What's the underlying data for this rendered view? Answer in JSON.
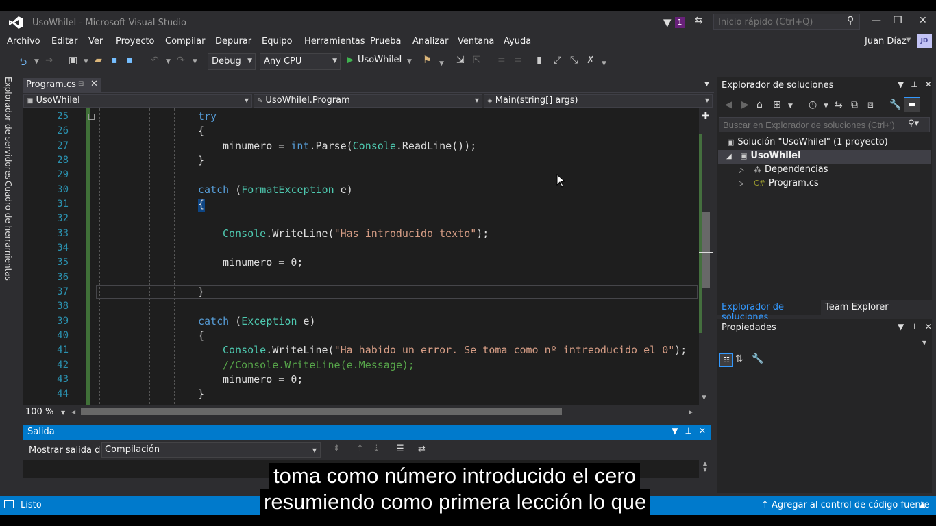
{
  "window": {
    "title": "UsoWhileI - Microsoft Visual Studio",
    "notification_count": "1",
    "quick_launch_placeholder": "Inicio rápido (Ctrl+Q)",
    "user_name": "Juan Díaz",
    "user_initials": "JD"
  },
  "menu": [
    "Archivo",
    "Editar",
    "Ver",
    "Proyecto",
    "Compilar",
    "Depurar",
    "Equipo",
    "Herramientas",
    "Prueba",
    "Analizar",
    "Ventana",
    "Ayuda"
  ],
  "toolbar": {
    "configuration": "Debug",
    "platform": "Any CPU",
    "run_label": "UsoWhileI"
  },
  "left_tabs": [
    "Explorador de servidores",
    "Cuadro de herramientas"
  ],
  "editor": {
    "tab_label": "Program.cs",
    "nav_project": "UsoWhileI",
    "nav_class": "UsoWhileI.Program",
    "nav_member": "Main(string[] args)",
    "zoom": "100 %",
    "line_numbers": [
      "25",
      "26",
      "27",
      "28",
      "29",
      "30",
      "31",
      "32",
      "33",
      "34",
      "35",
      "36",
      "37",
      "38",
      "39",
      "40",
      "41",
      "42",
      "43",
      "44"
    ]
  },
  "code": {
    "l25": "try",
    "l26": "{",
    "l27_a": "minumero = ",
    "l27_b": "int",
    "l27_c": ".Parse(",
    "l27_d": "Console",
    "l27_e": ".ReadLine());",
    "l28": "}",
    "l30_a": "catch",
    "l30_b": " (",
    "l30_c": "FormatException",
    "l30_d": " e)",
    "l31": "{",
    "l33_a": "Console",
    "l33_b": ".WriteLine(",
    "l33_c": "\"Has introducido texto\"",
    "l33_d": ");",
    "l35": "minumero = 0;",
    "l37": "}",
    "l39_a": "catch",
    "l39_b": " (",
    "l39_c": "Exception",
    "l39_d": " e)",
    "l40": "{",
    "l41_a": "Console",
    "l41_b": ".WriteLine(",
    "l41_c": "\"Ha habido un error. Se toma como nº intreoducido el 0\"",
    "l41_d": ");",
    "l42": "//Console.WriteLine(e.Message);",
    "l43": "minumero = 0;",
    "l44": "}"
  },
  "output": {
    "title": "Salida",
    "show_output_label": "Mostrar salida de:",
    "source": "Compilación"
  },
  "solution_explorer": {
    "title": "Explorador de soluciones",
    "search_placeholder": "Buscar en Explorador de soluciones (Ctrl+')",
    "solution": "Solución \"UsoWhileI\" (1 proyecto)",
    "project": "UsoWhileI",
    "dependencies": "Dependencias",
    "file": "Program.cs",
    "tab_active": "Explorador de soluciones",
    "tab_team": "Team Explorer"
  },
  "properties": {
    "title": "Propiedades"
  },
  "statusbar": {
    "status": "Listo",
    "scm": "Agregar al control de código fuente"
  },
  "subtitles": {
    "line1": "toma como número introducido el cero",
    "line2": "resumiendo como primera lección lo que"
  },
  "colors": {
    "accent": "#007acc",
    "keyword": "#569cd6",
    "type": "#4ec9b0",
    "string": "#d69d85",
    "comment": "#57a64a",
    "line_number": "#2b91af"
  }
}
